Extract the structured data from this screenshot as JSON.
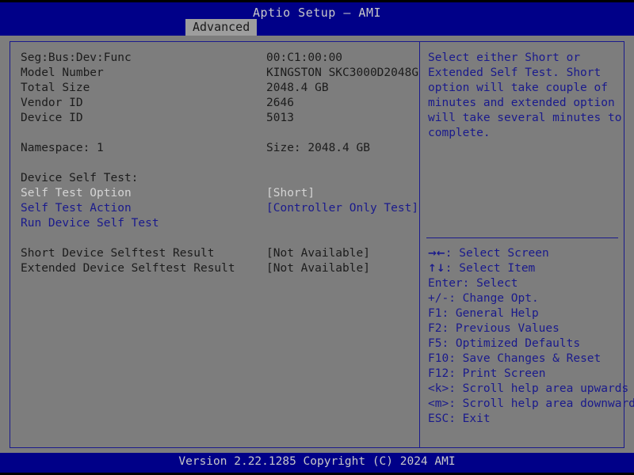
{
  "header": {
    "title": "Aptio Setup – AMI",
    "tabs": [
      {
        "label": "Advanced",
        "active": true
      }
    ]
  },
  "main": {
    "info_rows": [
      {
        "label": "Seg:Bus:Dev:Func",
        "value": "00:C1:00:00",
        "label_color": "dark",
        "value_color": "dark"
      },
      {
        "label": "Model Number",
        "value": "KINGSTON SKC3000D2048G",
        "label_color": "dark",
        "value_color": "dark"
      },
      {
        "label": "Total Size",
        "value": "2048.4 GB",
        "label_color": "dark",
        "value_color": "dark"
      },
      {
        "label": "Vendor ID",
        "value": "2646",
        "label_color": "dark",
        "value_color": "dark"
      },
      {
        "label": "Device ID",
        "value": "5013",
        "label_color": "dark",
        "value_color": "dark"
      }
    ],
    "namespace_row": {
      "label": "Namespace: 1",
      "value": "Size: 2048.4 GB"
    },
    "section_title": "Device Self Test:",
    "test_rows": [
      {
        "label": "Self Test Option",
        "value": "[Short]",
        "label_color": "gray",
        "value_color": "gray"
      },
      {
        "label": "Self Test Action",
        "value": "[Controller Only Test]",
        "label_color": "blue",
        "value_color": "blue"
      },
      {
        "label": "Run Device Self Test",
        "value": "",
        "label_color": "blue",
        "value_color": "blue"
      }
    ],
    "result_rows": [
      {
        "label": "Short Device Selftest Result",
        "value": "[Not Available]",
        "label_color": "dark",
        "value_color": "dark"
      },
      {
        "label": "Extended Device Selftest Result",
        "value": "[Not Available]",
        "label_color": "dark",
        "value_color": "dark"
      }
    ]
  },
  "help": {
    "lines": [
      "Select either Short or",
      "Extended Self Test. Short",
      "option will take couple of",
      "minutes and extended option",
      "will take several minutes to",
      "complete."
    ]
  },
  "legend": {
    "items": [
      {
        "keys": "→←",
        "text": ": Select Screen",
        "glyph": true
      },
      {
        "keys": "↑↓",
        "text": ": Select Item",
        "glyph": true
      },
      {
        "keys": "Enter",
        "text": ": Select",
        "glyph": false
      },
      {
        "keys": "+/-",
        "text": ": Change Opt.",
        "glyph": false
      },
      {
        "keys": "F1",
        "text": ": General Help",
        "glyph": false
      },
      {
        "keys": "F2",
        "text": ": Previous Values",
        "glyph": false
      },
      {
        "keys": "F5",
        "text": ": Optimized Defaults",
        "glyph": false
      },
      {
        "keys": "F10",
        "text": ": Save Changes & Reset",
        "glyph": false
      },
      {
        "keys": "F12",
        "text": ": Print Screen",
        "glyph": false
      },
      {
        "keys": "<k>",
        "text": ": Scroll help area upwards",
        "glyph": false
      },
      {
        "keys": "<m>",
        "text": ": Scroll help area downwards",
        "glyph": false
      },
      {
        "keys": "ESC",
        "text": ": Exit",
        "glyph": false
      }
    ]
  },
  "footer": {
    "text": "Version 2.22.1285 Copyright (C) 2024 AMI"
  },
  "colors": {
    "background": "#7d7d7d",
    "bar_blue": "#000088",
    "border_blue": "#1a1a8c",
    "text_dark": "#1c1c1c",
    "text_gray": "#d4d4d4",
    "tab_bg": "#9d9d9d"
  }
}
